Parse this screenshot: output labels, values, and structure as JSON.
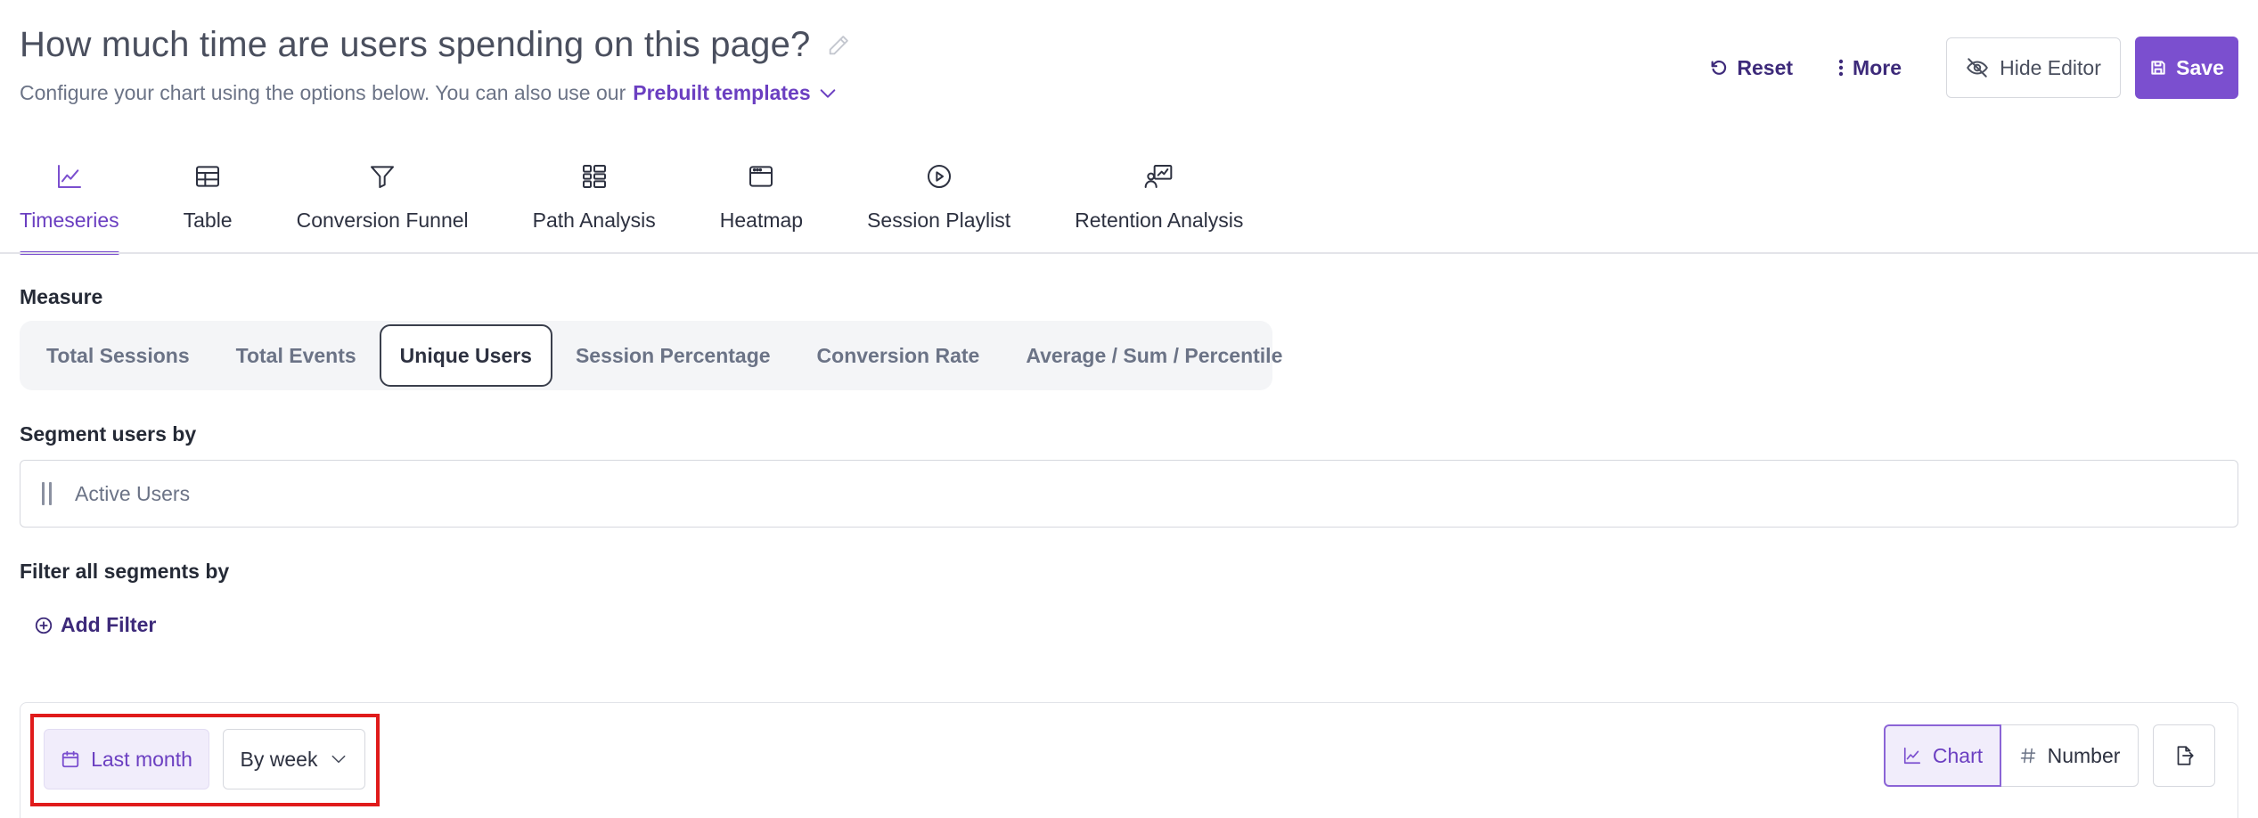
{
  "header": {
    "title": "How much time are users spending on this page?",
    "subtitle": "Configure your chart using the options below. You can also use our",
    "templates_link": "Prebuilt templates"
  },
  "actions": {
    "reset": "Reset",
    "more": "More",
    "hide_editor": "Hide Editor",
    "save": "Save"
  },
  "tabs": [
    {
      "label": "Timeseries",
      "icon": "line-chart-icon",
      "active": true
    },
    {
      "label": "Table",
      "icon": "table-icon"
    },
    {
      "label": "Conversion Funnel",
      "icon": "funnel-icon"
    },
    {
      "label": "Path Analysis",
      "icon": "path-analysis-icon"
    },
    {
      "label": "Heatmap",
      "icon": "heatmap-icon"
    },
    {
      "label": "Session Playlist",
      "icon": "play-circle-icon"
    },
    {
      "label": "Retention Analysis",
      "icon": "retention-icon"
    }
  ],
  "measure": {
    "label": "Measure",
    "options": [
      "Total Sessions",
      "Total Events",
      "Unique Users",
      "Session Percentage",
      "Conversion Rate",
      "Average / Sum / Percentile"
    ],
    "selected": "Unique Users"
  },
  "segment": {
    "label": "Segment users by",
    "value": "Active Users"
  },
  "filter": {
    "label": "Filter all segments by",
    "add_filter": "Add Filter"
  },
  "controls": {
    "date_range": "Last month",
    "granularity": "By week",
    "view_chart": "Chart",
    "view_number": "Number"
  },
  "colors": {
    "accent": "#7b4fcf",
    "accent_text": "#6b3fc1",
    "highlight": "#e01b1b"
  }
}
